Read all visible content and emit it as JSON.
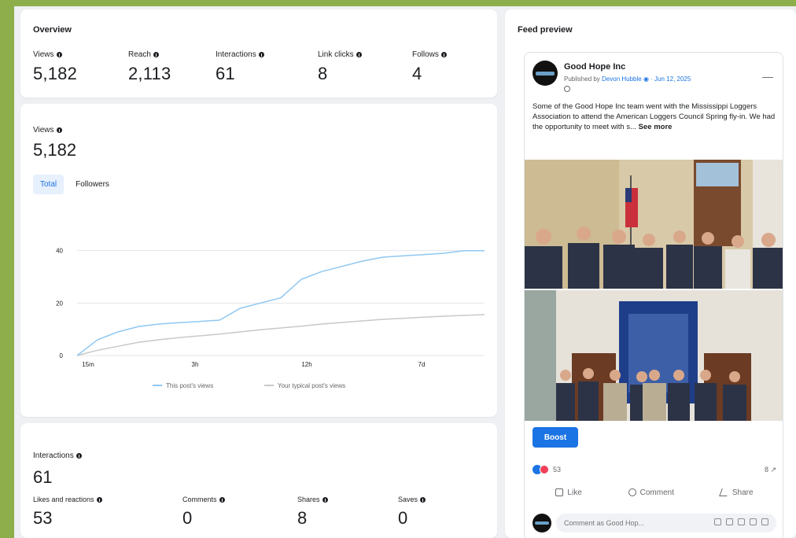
{
  "overview": {
    "title": "Overview",
    "metrics": [
      {
        "label": "Views",
        "value": "5,182"
      },
      {
        "label": "Reach",
        "value": "2,113"
      },
      {
        "label": "Interactions",
        "value": "61"
      },
      {
        "label": "Link clicks",
        "value": "8"
      },
      {
        "label": "Follows",
        "value": "4"
      }
    ]
  },
  "views": {
    "label": "Views",
    "value": "5,182",
    "tabs": [
      "Total",
      "Followers"
    ],
    "active_tab": "Total"
  },
  "chart_data": {
    "type": "line",
    "x": [
      0,
      2,
      4,
      6,
      8,
      10,
      12,
      14,
      16,
      18,
      20,
      22,
      24,
      26,
      28,
      30,
      32,
      34,
      36,
      38,
      40
    ],
    "x_ticks": [
      "15m",
      "3h",
      "12h",
      "7d"
    ],
    "y_ticks": [
      0,
      20,
      40
    ],
    "ylim": [
      0,
      48
    ],
    "series": [
      {
        "name": "This post's views",
        "color": "#8fc8f2",
        "values": [
          0,
          6,
          9,
          11,
          12,
          12.5,
          13,
          13.5,
          18,
          20,
          22,
          29,
          32,
          34,
          36,
          37.5,
          38,
          38.5,
          39,
          40,
          40
        ]
      },
      {
        "name": "Your typical post's views",
        "color": "#c8c8c8",
        "values": [
          0,
          2,
          3.5,
          5,
          6,
          6.8,
          7.5,
          8.2,
          9,
          9.8,
          10.5,
          11.2,
          12,
          12.6,
          13.2,
          13.8,
          14.2,
          14.6,
          15,
          15.3,
          15.6
        ]
      }
    ],
    "legend_position": "bottom",
    "grid": true
  },
  "interactions": {
    "label": "Interactions",
    "value": "61",
    "metrics": [
      {
        "label": "Likes and reactions",
        "value": "53"
      },
      {
        "label": "Comments",
        "value": "0"
      },
      {
        "label": "Shares",
        "value": "8"
      },
      {
        "label": "Saves",
        "value": "0"
      }
    ]
  },
  "feed": {
    "title": "Feed preview",
    "post": {
      "page_name": "Good Hope Inc",
      "byline_prefix": "Published by ",
      "byline_link": "Devon Hubble ◉ · Jun 12, 2025",
      "text": "Some of the Good Hope Inc team went with the Mississippi Loggers Association to attend the American Loggers Council Spring fly-in. We had the opportunity to meet with s...",
      "see_more": "See more",
      "boost_label": "Boost",
      "reaction_count": "53",
      "share_count": "8 ↗",
      "actions": [
        "Like",
        "Comment",
        "Share"
      ],
      "comment_placeholder": "Comment as Good Hop..."
    }
  }
}
